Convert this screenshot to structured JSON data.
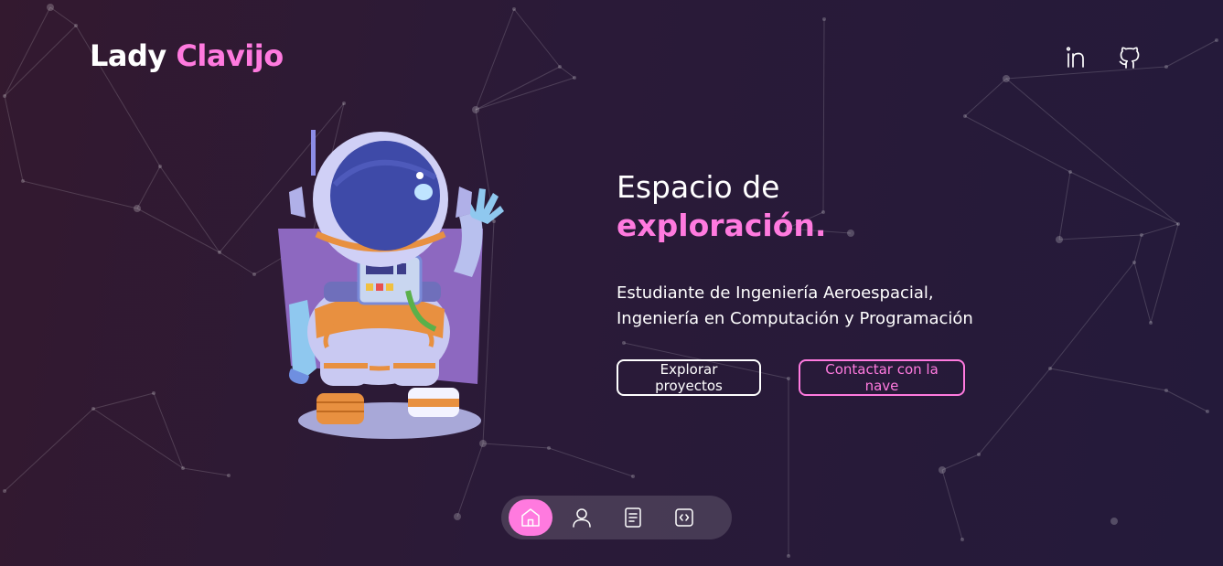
{
  "header": {
    "logo_first": "Lady",
    "logo_accent": "Clavijo",
    "social_links": [
      {
        "icon": "linkedin-icon"
      },
      {
        "icon": "github-icon"
      }
    ]
  },
  "hero": {
    "title_line1": "Espacio de",
    "title_accent": "exploración.",
    "description": "Estudiante de Ingeniería Aeroespacial, Ingeniería en Computación y Programación",
    "primary_button": "Explorar proyectos",
    "secondary_button": "Contactar con la nave"
  },
  "dock": {
    "items": [
      {
        "icon": "home-icon",
        "active": true
      },
      {
        "icon": "user-icon",
        "active": false
      },
      {
        "icon": "document-icon",
        "active": false
      },
      {
        "icon": "code-icon",
        "active": false
      }
    ]
  },
  "colors": {
    "accent": "#ff7adf",
    "background": "#2a1a38"
  }
}
